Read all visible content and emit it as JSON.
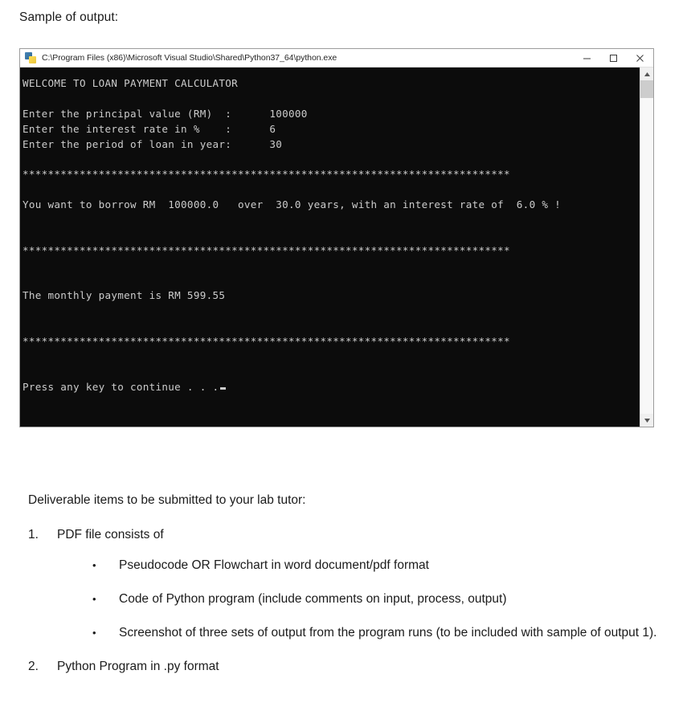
{
  "document": {
    "heading": "Sample of output:",
    "deliverable_intro": "Deliverable items to be submitted to your lab tutor:",
    "items": [
      {
        "number": "1.",
        "text": "PDF file consists of"
      },
      {
        "number": "2.",
        "text": "Python Program in .py format"
      }
    ],
    "bullets": [
      {
        "marker": "•",
        "text": "Pseudocode OR Flowchart in word document/pdf format"
      },
      {
        "marker": "•",
        "text": "Code of Python program (include comments on input, process, output)"
      },
      {
        "marker": "•",
        "text": "Screenshot of three sets of output from the program runs (to be included with sample of output 1)."
      }
    ]
  },
  "console_window": {
    "title": "C:\\Program Files (x86)\\Microsoft Visual Studio\\Shared\\Python37_64\\python.exe",
    "icon": "python-icon",
    "window_controls": {
      "minimize_label": "–",
      "maximize_label": "□",
      "close_label": "✕"
    },
    "scrollbar": {
      "up_arrow": "▲",
      "down_arrow": "▼"
    },
    "background_color": "#0c0c0c",
    "text_color": "#cccccc",
    "output_lines": [
      "WELCOME TO LOAN PAYMENT CALCULATOR",
      "",
      "Enter the principal value (RM)  :      100000",
      "Enter the interest rate in %    :      6",
      "Enter the period of loan in year:      30",
      "",
      "*****************************************************************************",
      "",
      "You want to borrow RM  100000.0   over  30.0 years, with an interest rate of  6.0 % !",
      "",
      "",
      "*****************************************************************************",
      "",
      "",
      "The monthly payment is RM 599.55",
      "",
      "",
      "*****************************************************************************",
      "",
      "",
      "Press any key to continue . . ."
    ]
  }
}
